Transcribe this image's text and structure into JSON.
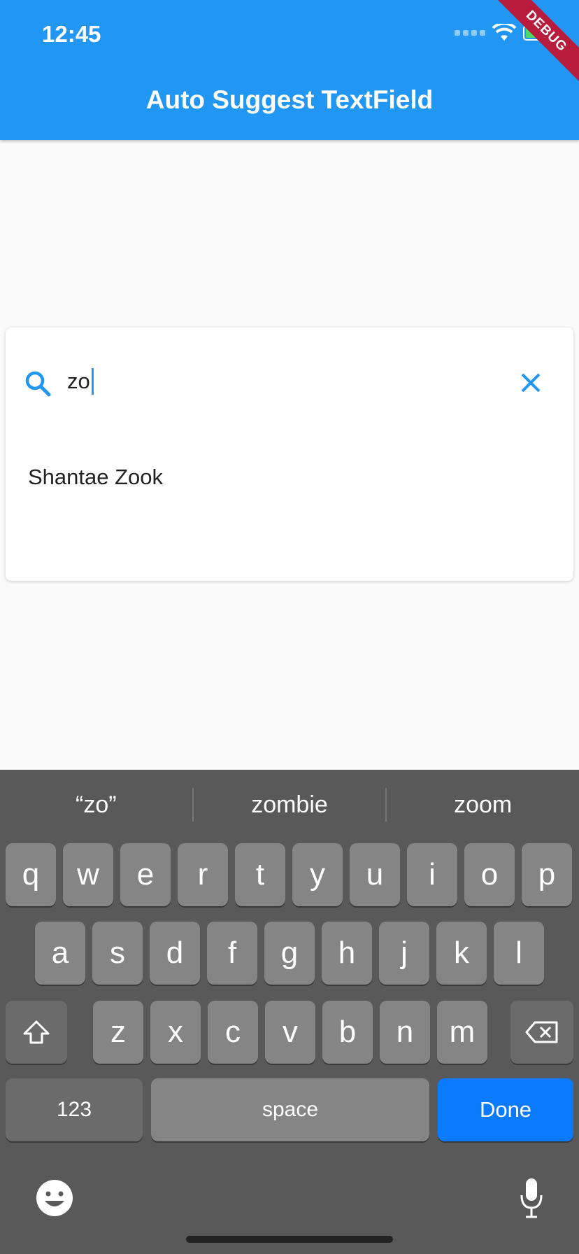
{
  "status_bar": {
    "time": "12:45"
  },
  "app_bar": {
    "title": "Auto Suggest TextField",
    "debug_label": "DEBUG"
  },
  "search": {
    "value": "zo"
  },
  "suggestions": [
    "Shantae Zook"
  ],
  "keyboard": {
    "predictions": [
      "“zo”",
      "zombie",
      "zoom"
    ],
    "row1": [
      "q",
      "w",
      "e",
      "r",
      "t",
      "y",
      "u",
      "i",
      "o",
      "p"
    ],
    "row2": [
      "a",
      "s",
      "d",
      "f",
      "g",
      "h",
      "j",
      "k",
      "l"
    ],
    "row3": [
      "z",
      "x",
      "c",
      "v",
      "b",
      "n",
      "m"
    ],
    "numbers_label": "123",
    "space_label": "space",
    "done_label": "Done"
  },
  "colors": {
    "primary": "#2196f3",
    "done_key": "#0a7aff",
    "keyboard_bg": "#595959"
  }
}
